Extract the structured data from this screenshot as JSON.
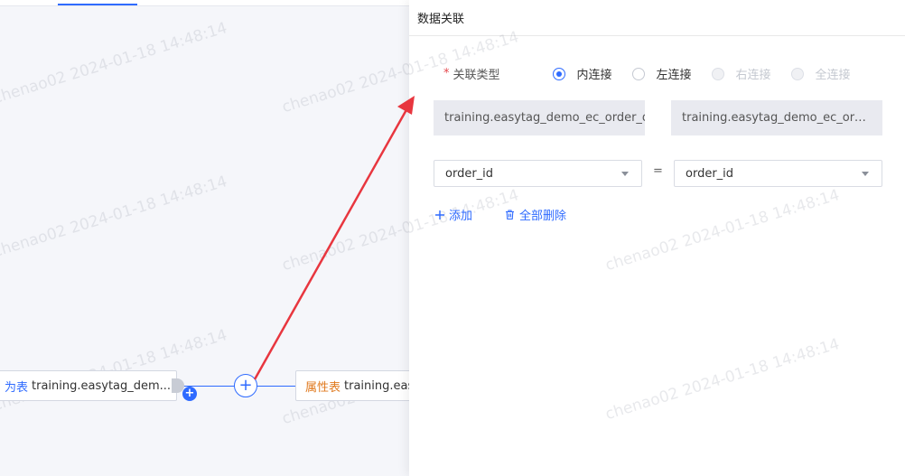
{
  "watermark": "chenao02 2024-01-18 14:48:14",
  "canvas": {
    "left_node": {
      "kind": "为表",
      "table": "training.easytag_dem..."
    },
    "right_node": {
      "kind": "属性表",
      "table": "training.easytag_demo_ec"
    },
    "join_symbol": "+",
    "port_symbol": "+"
  },
  "drawer": {
    "title": "数据关联",
    "join_type": {
      "required_mark": "*",
      "label": "关联类型",
      "options": [
        {
          "label": "内连接",
          "checked": true,
          "disabled": false
        },
        {
          "label": "左连接",
          "checked": false,
          "disabled": false
        },
        {
          "label": "右连接",
          "checked": false,
          "disabled": true
        },
        {
          "label": "全连接",
          "checked": false,
          "disabled": true
        }
      ]
    },
    "left_table": "training.easytag_demo_ec_order_d",
    "right_table": "training.easytag_demo_ec_order...",
    "condition": {
      "left_field": "order_id",
      "operator": "=",
      "right_field": "order_id"
    },
    "actions": {
      "add": "添加",
      "delete_all": "全部删除"
    }
  },
  "colors": {
    "accent": "#2f6bff",
    "arrow": "#e8363f",
    "attr_tag": "#e07a1f"
  }
}
